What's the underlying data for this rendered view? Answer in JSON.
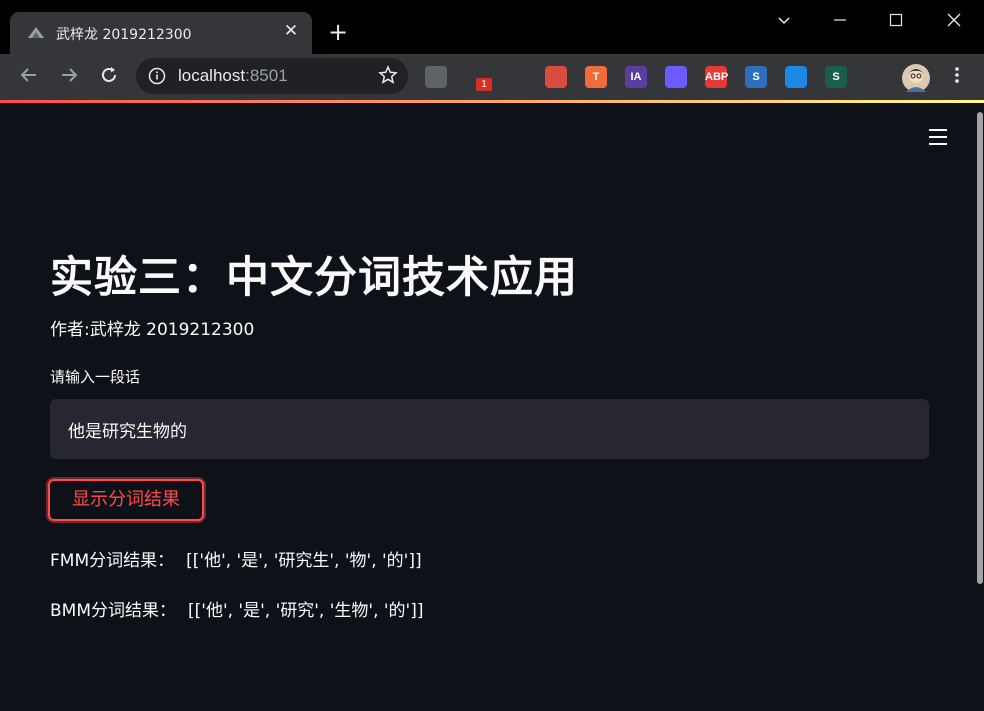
{
  "browser": {
    "tab_title": "武梓龙 2019212300",
    "tab_favicon": "streamlit-favicon-icon",
    "url_host": "localhost",
    "url_port": ":8501",
    "extension_badge": "1",
    "extensions": [
      {
        "name": "grid-extension-icon",
        "label": "",
        "color": "#5f6368"
      },
      {
        "name": "screen-extension-icon",
        "label": "",
        "color": "#35363a"
      },
      {
        "name": "triangle-extension-icon",
        "label": "",
        "color": "#35363a"
      },
      {
        "name": "todoist-icon",
        "label": "",
        "color": "#db4c3f"
      },
      {
        "name": "translate-icon",
        "label": "T",
        "color": "#f26b3a"
      },
      {
        "name": "ia-icon",
        "label": "IA",
        "color": "#5b3fa0"
      },
      {
        "name": "crescent-icon",
        "label": "",
        "color": "#6a5cff"
      },
      {
        "name": "adblock-icon",
        "label": "ABP",
        "color": "#e53935"
      },
      {
        "name": "s-blue-icon",
        "label": "S",
        "color": "#2d6fbd"
      },
      {
        "name": "pen-icon",
        "label": "",
        "color": "#1e88e5"
      },
      {
        "name": "s-green-icon",
        "label": "S",
        "color": "#1b5e4a"
      },
      {
        "name": "puzzle-icon",
        "label": "",
        "color": "#35363a"
      }
    ]
  },
  "app": {
    "title": "实验三：中文分词技术应用",
    "author": "作者:武梓龙 2019212300",
    "input_label": "请输入一段话",
    "input_value": "他是研究生物的",
    "button_label": "显示分词结果",
    "fmm_label": "FMM分词结果：",
    "fmm_value": "[['他', '是', '研究生', '物', '的']]",
    "bmm_label": "BMM分词结果：",
    "bmm_value": "[['他', '是', '研究', '生物', '的']]"
  },
  "colors": {
    "primary": "#ff4b4b",
    "background": "#0e1117",
    "input_bg": "#262730",
    "text": "#fafafa"
  }
}
